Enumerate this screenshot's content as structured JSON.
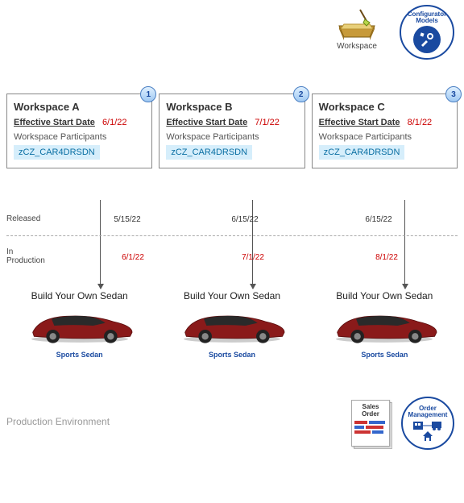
{
  "top": {
    "workspace_label": "Workspace",
    "configurator": {
      "label_line1": "Configurator",
      "label_line2": "Models"
    }
  },
  "cards": [
    {
      "step": "1",
      "title": "Workspace A",
      "eff_label": "Effective Start Date",
      "eff_date": "6/1/22",
      "participants_label": "Workspace Participants",
      "participant_code": "zCZ_CAR4DRSDN"
    },
    {
      "step": "2",
      "title": "Workspace B",
      "eff_label": "Effective Start Date",
      "eff_date": "7/1/22",
      "participants_label": "Workspace Participants",
      "participant_code": "zCZ_CAR4DRSDN"
    },
    {
      "step": "3",
      "title": "Workspace C",
      "eff_label": "Effective Start Date",
      "eff_date": "8/1/22",
      "participants_label": "Workspace Participants",
      "participant_code": "zCZ_CAR4DRSDN"
    }
  ],
  "flow": {
    "released_label": "Released",
    "released_dates": [
      "5/15/22",
      "6/15/22",
      "6/15/22"
    ],
    "inprod_label": "In\nProduction",
    "inprod_dates": [
      "6/1/22",
      "7/1/22",
      "8/1/22"
    ]
  },
  "builds": [
    {
      "title": "Build Your Own Sedan",
      "caption": "Sports Sedan"
    },
    {
      "title": "Build Your Own Sedan",
      "caption": "Sports Sedan"
    },
    {
      "title": "Build Your Own Sedan",
      "caption": "Sports Sedan"
    }
  ],
  "bottom": {
    "prod_env": "Production Environment",
    "sales_order": {
      "line1": "Sales",
      "line2": "Order"
    },
    "order_mgmt": {
      "label_line1": "Order",
      "label_line2": "Management"
    }
  },
  "colors": {
    "accent": "#1a4aa0",
    "danger": "#c00",
    "highlight": "#d6eefb",
    "car_body": "#8a1a1a"
  }
}
